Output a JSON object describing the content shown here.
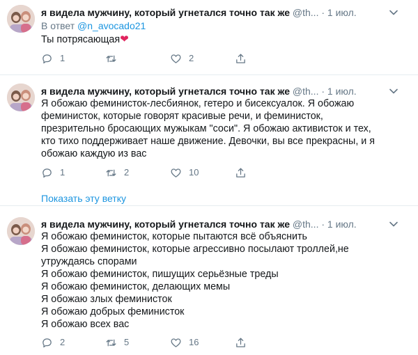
{
  "tweets": [
    {
      "author": "я видела мужчину, который угнетался точно так же",
      "handle": "@th...",
      "date": "1 июл.",
      "reply_label": "В ответ",
      "reply_mention": "@n_avocado21",
      "text_lines": [
        "Ты потрясающая"
      ],
      "emoji": "❤",
      "replies": "1",
      "retweets": "",
      "likes": "2"
    },
    {
      "author": "я видела мужчину, который угнетался точно так же",
      "handle": "@th...",
      "date": "1 июл.",
      "text_lines": [
        "Я обожаю феминисток-лесбиянок, гетеро и бисексуалок. Я обожаю",
        "феминисток, которые говорят красивые речи, и феминисток,",
        "презрительно бросающих мужыкам \"соси\". Я обожаю активисток и тех,",
        "кто тихо поддерживает наше движение. Девочки, вы все прекрасны, и я",
        "обожаю каждую из вас"
      ],
      "replies": "1",
      "retweets": "2",
      "likes": "10",
      "show_thread": "Показать эту ветку"
    },
    {
      "author": "я видела мужчину, который угнетался точно так же",
      "handle": "@th...",
      "date": "1 июл.",
      "text_lines": [
        "Я обожаю феминисток, которые пытаются всё объяснить",
        "Я обожаю феминисток, которые агрессивно посылают троллей,не",
        "утруждаясь спорами",
        "Я обожаю феминисток, пишущих серьёзные треды",
        "Я обожаю феминисток, делающих мемы",
        "Я обожаю злых феминисток",
        "Я обожаю добрых феминисток",
        "Я обожаю всех вас"
      ],
      "replies": "2",
      "retweets": "5",
      "likes": "16"
    }
  ],
  "icons": {
    "reply": "reply-icon",
    "retweet": "retweet-icon",
    "like": "heart-icon",
    "share": "share-icon",
    "caret": "chevron-down-icon"
  },
  "colors": {
    "text": "#14171a",
    "secondary": "#657786",
    "link": "#1b95e0",
    "divider": "#e6ecf0",
    "heart": "#e0245e"
  }
}
